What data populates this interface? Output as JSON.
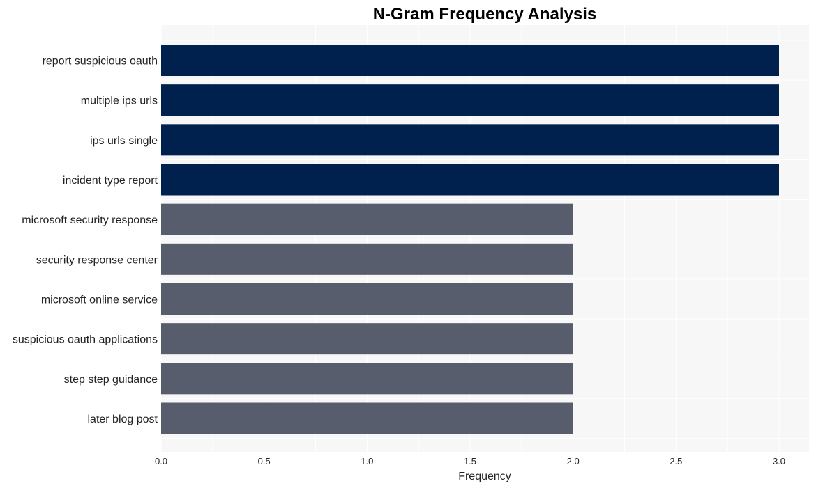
{
  "chart_data": {
    "type": "bar",
    "orientation": "horizontal",
    "title": "N-Gram Frequency Analysis",
    "xlabel": "Frequency",
    "ylabel": "",
    "categories": [
      "report suspicious oauth",
      "multiple ips urls",
      "ips urls single",
      "incident type report",
      "microsoft security response",
      "security response center",
      "microsoft online service",
      "suspicious oauth applications",
      "step step guidance",
      "later blog post"
    ],
    "values": [
      3,
      3,
      3,
      3,
      2,
      2,
      2,
      2,
      2,
      2
    ],
    "bar_colors": [
      "#00204e",
      "#00204e",
      "#00204e",
      "#00204e",
      "#575d6d",
      "#575d6d",
      "#575d6d",
      "#575d6d",
      "#575d6d",
      "#575d6d"
    ],
    "xlim": [
      0,
      3.15
    ],
    "xticks": [
      "0.0",
      "0.5",
      "1.0",
      "1.5",
      "2.0",
      "2.5",
      "3.0"
    ],
    "xtick_values": [
      0,
      0.5,
      1.0,
      1.5,
      2.0,
      2.5,
      3.0
    ],
    "grid": true,
    "legend": "none",
    "background": "#f7f7f7"
  }
}
